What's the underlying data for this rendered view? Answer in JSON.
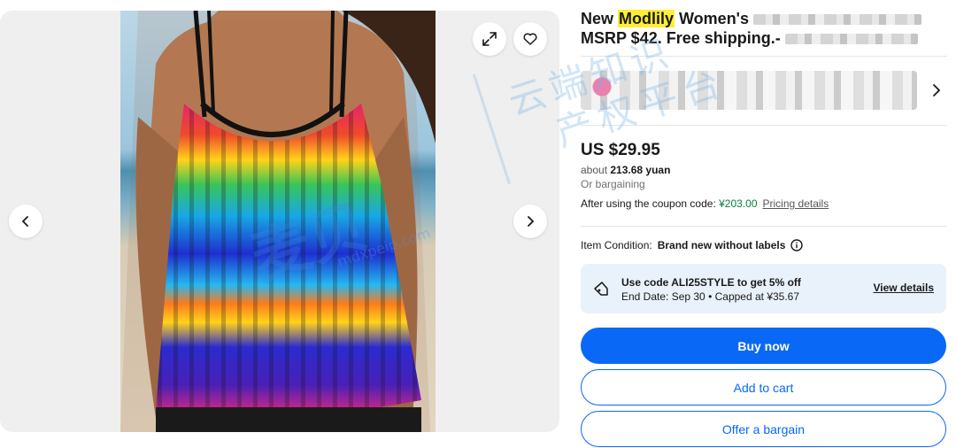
{
  "listing": {
    "title_prefix": "New ",
    "title_brand": "Modlily",
    "title_rest": " Women's",
    "title_line2": "MSRP $42. Free shipping.-"
  },
  "price": {
    "main": "US $29.95",
    "approx_prefix": "about ",
    "approx_value": "213.68 yuan",
    "bargaining": "Or bargaining",
    "coupon_label": "After using the coupon code: ",
    "coupon_price": "¥203.00",
    "pricing_details": "Pricing details"
  },
  "condition": {
    "label": "Item Condition:",
    "value": "Brand new without labels"
  },
  "promo": {
    "line1": "Use code ALI25STYLE to get 5% off",
    "line2": "End Date: Sep 30 • Capped at ¥35.67",
    "link": "View details"
  },
  "actions": {
    "buy_now": "Buy now",
    "add_to_cart": "Add to cart",
    "offer": "Offer a bargain"
  },
  "watermark": {
    "chinese_line1": "云端知识",
    "chinese_line2": "产权平台",
    "logo": "麦贝",
    "url": "mdxpeip.com"
  },
  "colors": {
    "primary": "#0968f6",
    "highlight": "#ffee32",
    "coupon_green": "#05823f",
    "promo_bg": "#e9f2fb"
  }
}
